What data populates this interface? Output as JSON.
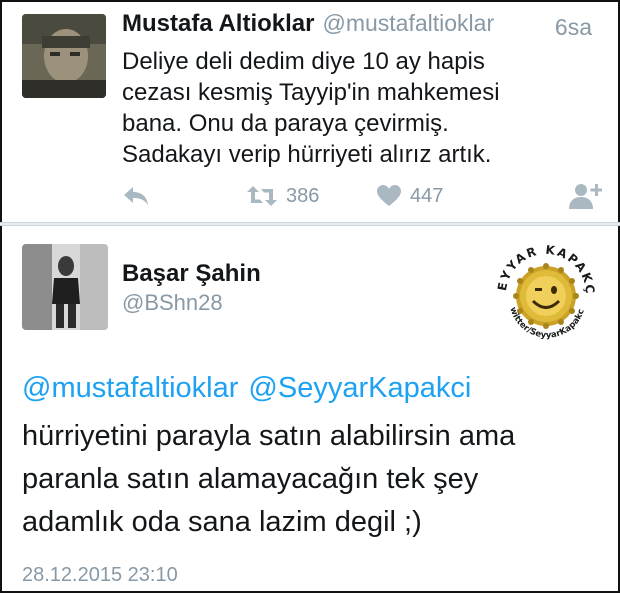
{
  "tweets": [
    {
      "author_name": "Mustafa Altioklar",
      "author_handle": "@mustafaltioklar",
      "time_ago": "6sa",
      "text_lines": [
        "Deliye deli dedim diye 10 ay hapis",
        "cezası kesmiş Tayyip'in mahkemesi",
        "bana. Onu da paraya çevirmiş.",
        "Sadakayı verip hürriyeti alırız artık."
      ],
      "actions": {
        "retweet_count": "386",
        "like_count": "447"
      },
      "icons": [
        "reply-icon",
        "retweet-icon",
        "heart-icon",
        "follow-icon"
      ]
    },
    {
      "author_name": "Başar Şahin",
      "author_handle": "@BShn28",
      "mentions": [
        "@mustafaltioklar",
        "@SeyyarKapakci"
      ],
      "text_lines": [
        "hürriyetini parayla satın alabilirsin ama",
        "paranla satın alamayacağın tek şey",
        "adamlık oda sana lazim degil ;)"
      ],
      "timestamp": "28.12.2015 23:10",
      "watermark": {
        "top_text": "SEYYAR KAPAKÇI",
        "bottom_text": "Twitter/SeyyarKapakci"
      }
    }
  ],
  "colors": {
    "link": "#1da1f2",
    "muted": "#8899a6",
    "icon": "#aab8c2",
    "text": "#14171a",
    "separator": "#e6ecf0"
  }
}
